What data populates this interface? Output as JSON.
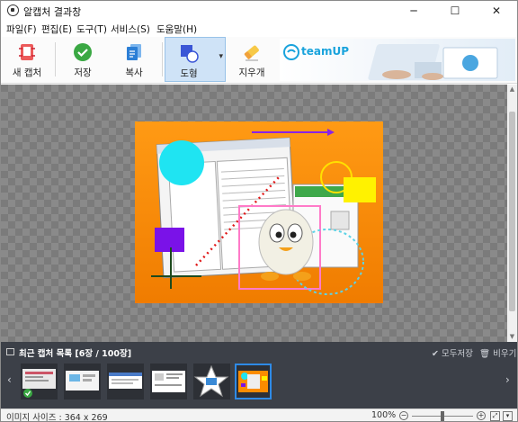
{
  "window": {
    "title": "알캡처 결과창",
    "minimize": "─",
    "maximize": "☐",
    "close": "✕"
  },
  "menu": [
    "파일(F)",
    "편집(E)",
    "도구(T)",
    "서비스(S)",
    "도움말(H)"
  ],
  "toolbar": {
    "new_capture": "새 캡처",
    "save": "저장",
    "copy": "복사",
    "shape": "도형",
    "eraser": "지우개",
    "dropdown": "▾"
  },
  "banner": {
    "brand": "teamUP"
  },
  "recent": {
    "title": "최근 캡처 목록 [6장 / 100장]",
    "save_all": "모두저장",
    "clear": "비우기",
    "prev": "‹",
    "next": "›",
    "thumb_count": 6,
    "selected_index": 5
  },
  "status": {
    "image_size": "이미지 사이즈 : 364 x 269",
    "zoom": "100%",
    "zoom_level": 0.5,
    "zoom_out": "−",
    "zoom_in": "+"
  },
  "colors": {
    "accent": "#2e8ae6",
    "image_bg": "#fb8c00",
    "panel": "#3c4048"
  }
}
